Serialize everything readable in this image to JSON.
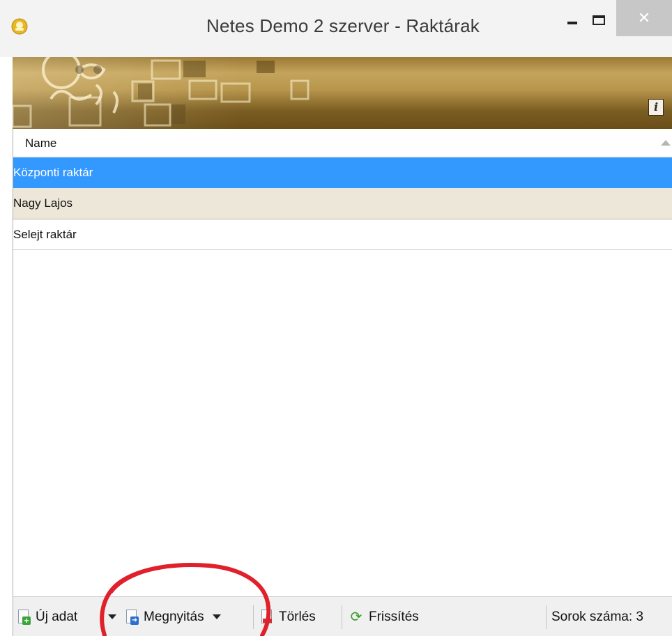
{
  "window": {
    "title": "Netes Demo 2 szerver - Raktárak",
    "controls": {
      "minimize": "minimize",
      "maximize": "maximize",
      "close": "✕"
    }
  },
  "banner": {
    "info_icon": "i"
  },
  "grid": {
    "columns": [
      "Name"
    ],
    "rows": [
      {
        "name": "Központi raktár",
        "selected": true
      },
      {
        "name": "Nagy Lajos",
        "selected": false
      },
      {
        "name": "Selejt raktár",
        "selected": false
      }
    ]
  },
  "toolbar": {
    "new_label": "Új adat",
    "open_label": "Megnyitás",
    "delete_label": "Törlés",
    "refresh_label": "Frissítés",
    "row_count_label": "Sorok száma: 3"
  },
  "icons": {
    "app": "app-icon",
    "new": "new-document-icon",
    "open": "open-document-icon",
    "delete": "delete-document-icon",
    "refresh": "refresh-icon",
    "info": "info-icon"
  },
  "colors": {
    "selection": "#3399ff",
    "alt_row": "#ede7d9",
    "annotation": "#e0202a",
    "banner_gold": "#b8964c"
  }
}
